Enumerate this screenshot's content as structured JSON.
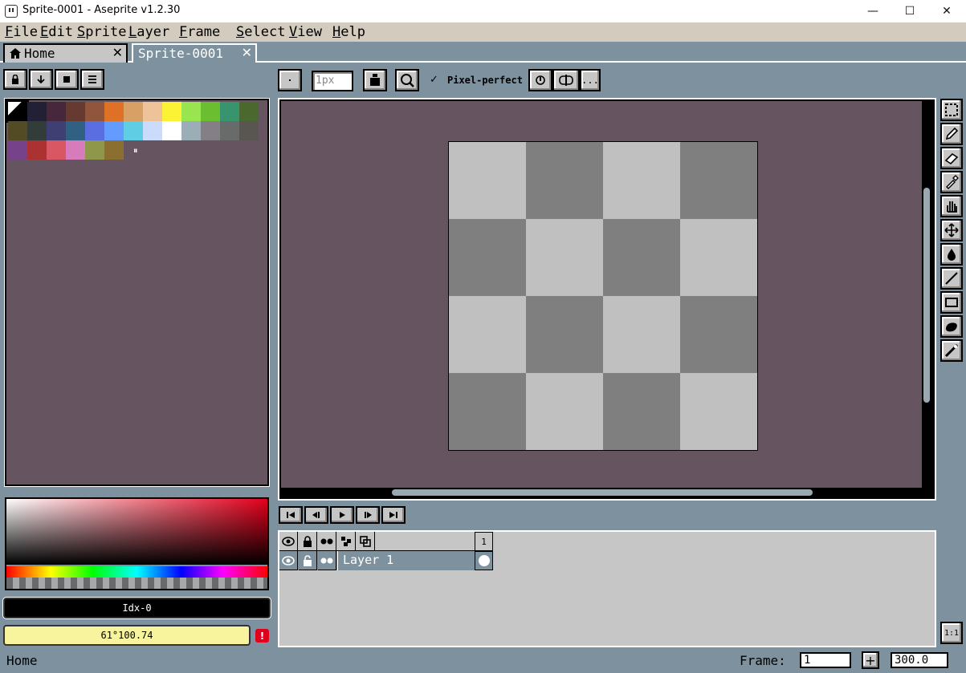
{
  "window": {
    "title": "Sprite-0001 - Aseprite v1.2.30",
    "minimize": "—",
    "maximize": "☐",
    "close": "✕"
  },
  "menu": [
    "File",
    "Edit",
    "Sprite",
    "Layer",
    "Frame",
    "Select",
    "View",
    "Help"
  ],
  "tabs": [
    {
      "label": "Home",
      "close": "✕"
    },
    {
      "label": "Sprite-0001",
      "close": "✕"
    }
  ],
  "context_bar": {
    "brush_size_value": "1px",
    "pixel_perfect_check": "✓",
    "pixel_perfect_label": "Pixel-perfect",
    "more_label": "..."
  },
  "palette": {
    "colors": [
      "#000000",
      "#222034",
      "#45283c",
      "#663931",
      "#8f563b",
      "#df7126",
      "#d9a066",
      "#eec39a",
      "#fbf236",
      "#99e550",
      "#6abe30",
      "#37946e",
      "#4b692f",
      "#524b24",
      "#323c39",
      "#3f3f74",
      "#306082",
      "#5b6ee1",
      "#639bff",
      "#5fcde4",
      "#cbdbfc",
      "#ffffff",
      "#9badb7",
      "#847e87",
      "#696a6a",
      "#595652",
      "#76428a",
      "#ac3232",
      "#d95763",
      "#d77bba",
      "#8f974a",
      "#8a6f30"
    ],
    "more_indicator": "⏸"
  },
  "color_fields": {
    "index": "Idx-0",
    "hex": "61°100.74",
    "warning": "!"
  },
  "timeline": {
    "frame_number": "1",
    "layer_name": "Layer 1"
  },
  "status": {
    "text": "Home",
    "frame_label": "Frame:",
    "frame_value": "1",
    "add_label": "+",
    "zoom_value": "300.0",
    "zoom_reset_label": "1:1"
  }
}
